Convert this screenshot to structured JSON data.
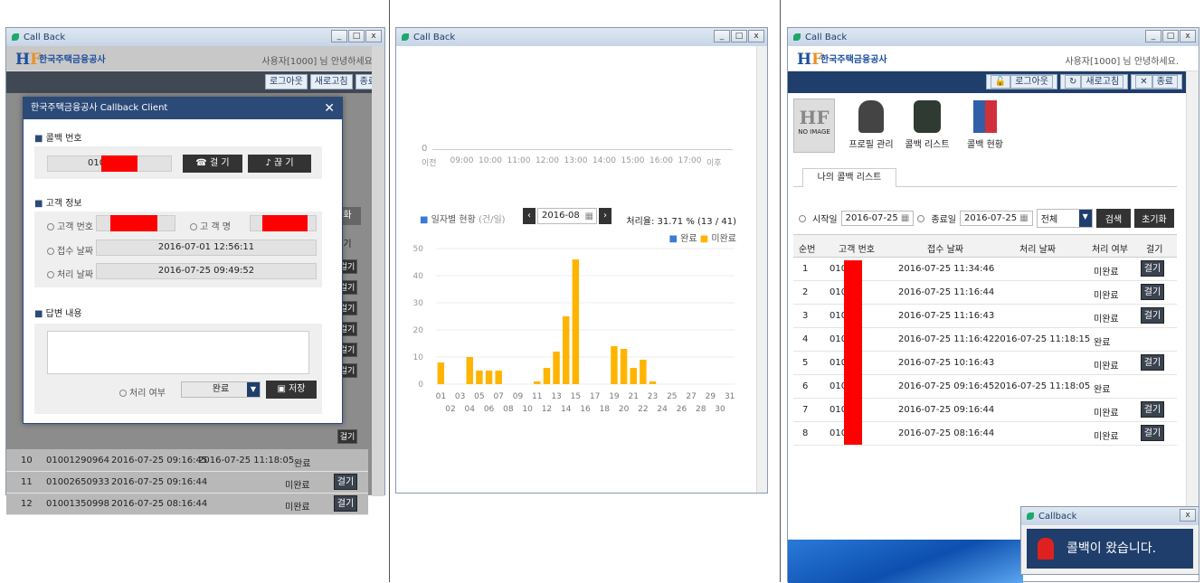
{
  "app": {
    "title": "Call Back",
    "user_text": "사용자[1000] 님 안녕하세요.",
    "org": "한국주택금융공사",
    "logout": "로그아웃",
    "refresh": "새로고침",
    "exit": "종료"
  },
  "dialog": {
    "title": "한국주택금융공사 Callback Client",
    "sec_callback": "콜백 번호",
    "callback_num": "010",
    "call_btn": "걸 기",
    "hang_btn": "끊 기",
    "sec_customer": "고객 정보",
    "cust_no_label": "고객 번호",
    "cust_name_label": "고 객 명",
    "recv_label": "접수 날짜",
    "recv_val": "2016-07-01 12:56:11",
    "proc_label": "처리 날짜",
    "proc_val": "2016-07-25 09:49:52",
    "sec_answer": "답변 내용",
    "status_label": "처리 여부",
    "status_val": "완료",
    "save": "저장"
  },
  "bg_rows": [
    {
      "n": "10",
      "phone": "01001290964",
      "recv": "2016-07-25 09:16:45",
      "proc": "2016-07-25 11:18:05",
      "status": "완료",
      "btn": ""
    },
    {
      "n": "11",
      "phone": "01002650933",
      "recv": "2016-07-25 09:16:44",
      "proc": "",
      "status": "미완료",
      "btn": "걸기"
    },
    {
      "n": "12",
      "phone": "01001350998",
      "recv": "2016-07-25 08:16:44",
      "proc": "",
      "status": "미완료",
      "btn": "걸기"
    }
  ],
  "bg_btn": "걸기",
  "bg_right_btn": "화",
  "bg_col": "기",
  "chart1": {
    "zero": "0",
    "ticks": [
      "이전",
      "09:00",
      "10:00",
      "11:00",
      "12:00",
      "13:00",
      "14:00",
      "15:00",
      "16:00",
      "17:00",
      "이후"
    ]
  },
  "daily": {
    "title": "일자별 현황",
    "unit": "(건/일)",
    "month": "2016-08",
    "rate": "처리율: 31.71 % (13 / 41)",
    "legend_done": "완료",
    "legend_pending": "미완료"
  },
  "chart_data": {
    "type": "bar",
    "categories": [
      "01",
      "02",
      "03",
      "04",
      "05",
      "06",
      "07",
      "08",
      "09",
      "10",
      "11",
      "12",
      "13",
      "14",
      "15",
      "16",
      "17",
      "18",
      "19",
      "20",
      "21",
      "22",
      "23",
      "24",
      "25",
      "26",
      "27",
      "28",
      "29",
      "30",
      "31"
    ],
    "series": [
      {
        "name": "완료",
        "values": [
          0,
          0,
          0,
          0,
          0,
          0,
          0,
          0,
          0,
          0,
          0,
          0,
          0,
          0,
          0,
          0,
          0,
          0,
          0,
          0,
          0,
          0,
          0,
          0,
          0,
          0,
          0,
          0,
          0,
          0,
          0
        ]
      },
      {
        "name": "미완료",
        "values": [
          8,
          0,
          0,
          10,
          5,
          5,
          5,
          0,
          0,
          0,
          1,
          6,
          12,
          25,
          46,
          0,
          0,
          0,
          14,
          13,
          6,
          9,
          1,
          0,
          0,
          0,
          0,
          0,
          0,
          0,
          0
        ]
      }
    ],
    "yticks": [
      0,
      10,
      20,
      30,
      40,
      50
    ],
    "ylim": [
      0,
      50
    ],
    "colors": {
      "done": "#3a7bd5",
      "pending": "#ffb400"
    }
  },
  "right": {
    "noimage": "NO IMAGE",
    "menu": [
      "프로필 관리",
      "콜백 리스트",
      "콜백 현황"
    ],
    "tab": "나의 콜백 리스트",
    "start_label": "시작일",
    "start": "2016-07-25",
    "end_label": "종료일",
    "end": "2016-07-25",
    "filter": "전체",
    "search": "검색",
    "reset": "초기화",
    "headers": [
      "순번",
      "고객 번호",
      "접수 날짜",
      "처리 날짜",
      "처리 여부",
      "걸기"
    ],
    "rows": [
      {
        "n": "1",
        "phone": "010",
        "recv": "2016-07-25 11:34:46",
        "proc": "",
        "status": "미완료",
        "btn": "걸기"
      },
      {
        "n": "2",
        "phone": "010",
        "recv": "2016-07-25 11:16:44",
        "proc": "",
        "status": "미완료",
        "btn": "걸기"
      },
      {
        "n": "3",
        "phone": "010",
        "recv": "2016-07-25 11:16:43",
        "proc": "",
        "status": "미완료",
        "btn": "걸기"
      },
      {
        "n": "4",
        "phone": "010",
        "recv": "2016-07-25 11:16:42",
        "proc": "2016-07-25 11:18:15",
        "status": "완료",
        "btn": ""
      },
      {
        "n": "5",
        "phone": "010",
        "recv": "2016-07-25 10:16:43",
        "proc": "",
        "status": "미완료",
        "btn": "걸기"
      },
      {
        "n": "6",
        "phone": "010",
        "recv": "2016-07-25 09:16:45",
        "proc": "2016-07-25 11:18:05",
        "status": "완료",
        "btn": ""
      },
      {
        "n": "7",
        "phone": "010",
        "recv": "2016-07-25 09:16:44",
        "proc": "",
        "status": "미완료",
        "btn": "걸기"
      },
      {
        "n": "8",
        "phone": "010",
        "recv": "2016-07-25 08:16:44",
        "proc": "",
        "status": "미완료",
        "btn": "걸기"
      }
    ]
  },
  "toast": {
    "title": "Callback",
    "message": "콜백이 왔습니다."
  }
}
